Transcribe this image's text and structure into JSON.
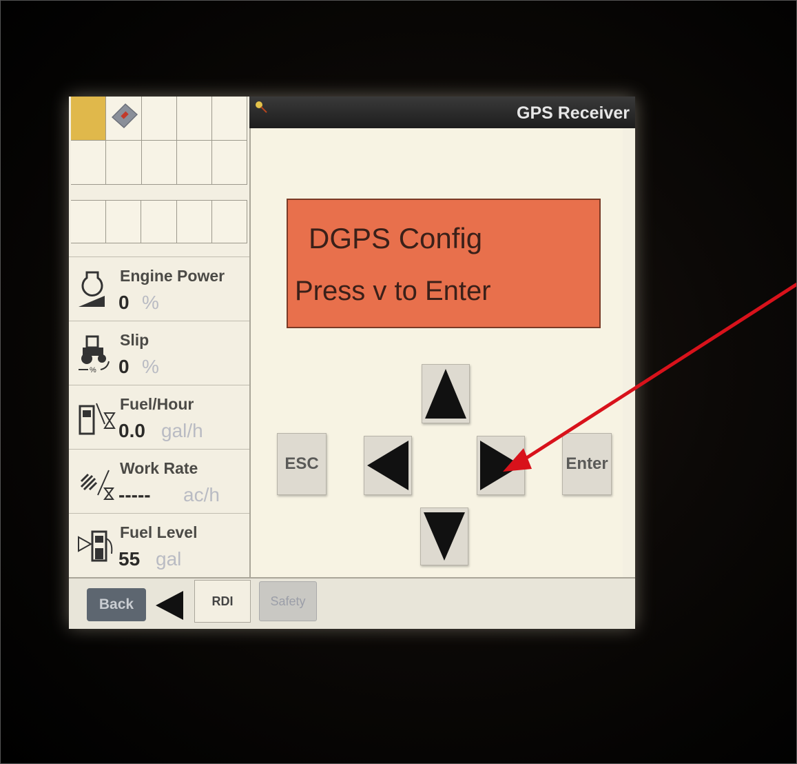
{
  "header": {
    "title": "GPS Receiver"
  },
  "display": {
    "line1": "DGPS Config",
    "line2": "Press v to Enter"
  },
  "keypad": {
    "esc_label": "ESC",
    "enter_label": "Enter"
  },
  "metrics": [
    {
      "label": "Engine Power",
      "value": "0",
      "unit": "%",
      "icon": "engine-icon"
    },
    {
      "label": "Slip",
      "value": "0",
      "unit": "%",
      "icon": "tractor-slip-icon"
    },
    {
      "label": "Fuel/Hour",
      "value": "0.0",
      "unit": "gal/h",
      "icon": "fuel-hour-icon"
    },
    {
      "label": "Work Rate",
      "value": "-----",
      "unit": "ac/h",
      "icon": "work-rate-icon"
    },
    {
      "label": "Fuel Level",
      "value": "55",
      "unit": "gal",
      "icon": "fuel-level-icon"
    }
  ],
  "bottom": {
    "back_label": "Back",
    "rdi_label": "RDI",
    "safety_label": "Safety"
  },
  "colors": {
    "display_bg": "#e8704c",
    "selected_cell": "#e0b84b",
    "annotation_arrow": "#d8121b"
  }
}
